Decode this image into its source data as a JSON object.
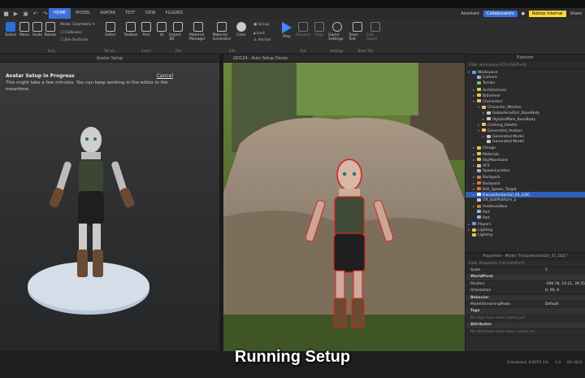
{
  "menu": {
    "tabs": [
      "HOME",
      "MODEL",
      "AVATAR",
      "TEST",
      "VIEW",
      "PLUGINS"
    ],
    "active": "HOME",
    "assistant": "Assistant",
    "collaborators": "Collaborators",
    "internal_badge": "Roblox Internal",
    "share": "Share"
  },
  "ribbon": {
    "select": "Select",
    "move": "Move",
    "scale": "Scale",
    "rotate": "Rotate",
    "mode_label": "Mode:",
    "mode_value": "Geometric",
    "collisions": "Collisions",
    "join_surfaces": "Join Surfaces",
    "editor": "Editor",
    "toolbox": "Toolbox",
    "part": "Part",
    "ui": "UI",
    "import3d": "Import 3D",
    "material_manager": "Material Manager",
    "material_generator": "Material Generator",
    "color": "Color",
    "group": "Group",
    "lock": "Lock",
    "anchor": "Anchor",
    "play": "Play",
    "resume": "Resume",
    "stop": "Stop",
    "game_settings": "Game Settings",
    "team_test": "Team Test",
    "exit_game": "Exit Game",
    "groups": [
      "Tools",
      "Terrain",
      "Insert",
      "File",
      "Edit",
      "Test",
      "Settings",
      "Team Test"
    ]
  },
  "avatar_panel": {
    "title": "Avatar Setup",
    "notice_title": "Avatar Setup in Progress",
    "notice_text": "This might take a few minutes. You can keep working in the editor in the meantime.",
    "cancel": "Cancel"
  },
  "viewport": {
    "tab": "GDC24 - Auto Setup Demo"
  },
  "explorer": {
    "title": "Explorer",
    "filter": "Filter workspace (Ctrl+Shift+X)",
    "items": [
      {
        "label": "Workspace",
        "depth": 0,
        "arrow": "▾",
        "color": "#5aa0ff"
      },
      {
        "label": "Camera",
        "depth": 1,
        "arrow": "",
        "color": "#8fb4e8"
      },
      {
        "label": "Terrain",
        "depth": 1,
        "arrow": "",
        "color": "#6fbf6f"
      },
      {
        "label": "Architectural",
        "depth": 1,
        "arrow": "▸",
        "color": "#e8c25a"
      },
      {
        "label": "Bitheimer",
        "depth": 1,
        "arrow": "▸",
        "color": "#e8c25a"
      },
      {
        "label": "Characters",
        "depth": 1,
        "arrow": "▾",
        "color": "#e8c25a"
      },
      {
        "label": "Character_Meshes",
        "depth": 2,
        "arrow": "▾",
        "color": "#e8c25a"
      },
      {
        "label": "RuboxHeadGirl_BaseBody",
        "depth": 3,
        "arrow": "▸",
        "color": "#c8c8c8"
      },
      {
        "label": "StylizedMale_BaseBody",
        "depth": 3,
        "arrow": "▸",
        "color": "#c8c8c8"
      },
      {
        "label": "Clothing_Palette",
        "depth": 2,
        "arrow": "▸",
        "color": "#e8c25a"
      },
      {
        "label": "Generated_Avatars",
        "depth": 2,
        "arrow": "▾",
        "color": "#e8c25a"
      },
      {
        "label": "Generated Model",
        "depth": 3,
        "arrow": "▸",
        "color": "#c8c8c8"
      },
      {
        "label": "Generated Model",
        "depth": 3,
        "arrow": "",
        "color": "#c8c8c8"
      },
      {
        "label": "Foliage",
        "depth": 1,
        "arrow": "▸",
        "color": "#e8c25a"
      },
      {
        "label": "Materials",
        "depth": 1,
        "arrow": "▸",
        "color": "#e8c25a"
      },
      {
        "label": "SkyMountains",
        "depth": 1,
        "arrow": "▸",
        "color": "#e8c25a"
      },
      {
        "label": "VFX",
        "depth": 1,
        "arrow": "▸",
        "color": "#e8c25a"
      },
      {
        "label": "SpawnLocation",
        "depth": 1,
        "arrow": "",
        "color": "#8fb4e8"
      },
      {
        "label": "Backpack",
        "depth": 1,
        "arrow": "▸",
        "color": "#d07a3a"
      },
      {
        "label": "Backpack",
        "depth": 1,
        "arrow": "▸",
        "color": "#d07a3a"
      },
      {
        "label": "Ball_Spawn_Target",
        "depth": 1,
        "arrow": "▸",
        "color": "#d07a3a"
      },
      {
        "label": "FixtureArcherGirl_01_GDC",
        "depth": 1,
        "arrow": "▸",
        "color": "#ffffff",
        "selected": true
      },
      {
        "label": "Oft_BallPlatform_a",
        "depth": 1,
        "arrow": "",
        "color": "#c8c8c8"
      },
      {
        "label": "medievaldoor",
        "depth": 1,
        "arrow": "▸",
        "color": "#d07a3a"
      },
      {
        "label": "Part",
        "depth": 1,
        "arrow": "",
        "color": "#8fb4e8"
      },
      {
        "label": "Part",
        "depth": 1,
        "arrow": "",
        "color": "#8fb4e8"
      },
      {
        "label": "Players",
        "depth": 0,
        "arrow": "▸",
        "color": "#5aa0ff"
      },
      {
        "label": "Lighting",
        "depth": 0,
        "arrow": "▸",
        "color": "#e8c25a"
      },
      {
        "label": "Lighting",
        "depth": 0,
        "arrow": "",
        "color": "#e8c25a"
      }
    ]
  },
  "properties": {
    "title": "Properties - Model \"FixtureArcherGirl_01_GDC\"",
    "filter": "Filter Properties (Ctrl+Shift+P)",
    "rows": [
      {
        "name": "Scale",
        "value": "1",
        "section": false
      },
      {
        "name": "WorldPivot",
        "value": "",
        "section": true
      },
      {
        "name": "Position",
        "value": "-296.78, 19.11, 39.359",
        "section": false
      },
      {
        "name": "Orientation",
        "value": "0, 90, 0",
        "section": false
      },
      {
        "name": "Behavior",
        "value": "",
        "section": true
      },
      {
        "name": "ModelStreamingMode",
        "value": "Default",
        "section": false
      },
      {
        "name": "Tags",
        "value": "",
        "section": true
      },
      {
        "name": "No Tags have been added yet",
        "value": "",
        "section": false,
        "hint": true
      },
      {
        "name": "Attributes",
        "value": "",
        "section": true
      },
      {
        "name": "No Attributes have been added yet",
        "value": "",
        "section": false,
        "hint": true
      }
    ]
  },
  "status": {
    "caption": "Running Setup",
    "scheduled": "Scheduled: 630/55.1%",
    "fps": "1.0",
    "time": "KG 00.8"
  }
}
